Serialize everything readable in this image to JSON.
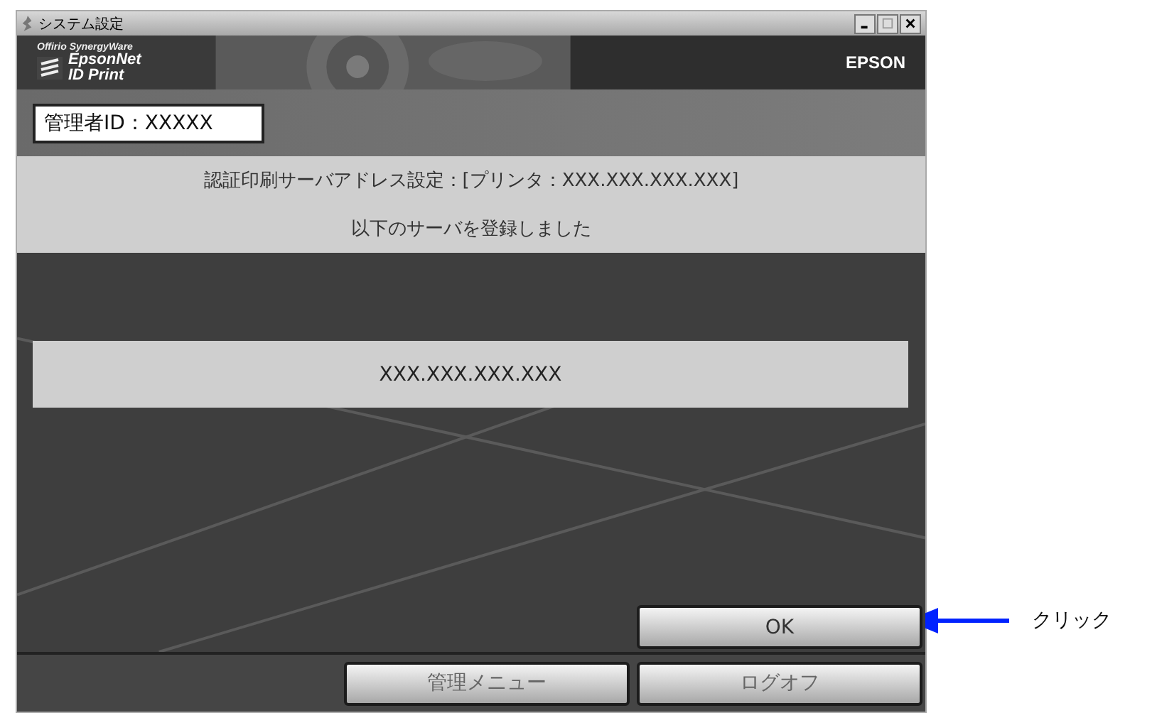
{
  "window": {
    "title": "システム設定"
  },
  "header": {
    "tagline": "Offirio SynergyWare",
    "product_line1": "EpsonNet",
    "product_line2": "ID Print",
    "brand": "EPSON"
  },
  "admin_id": {
    "value": "管理者ID：XXXXX"
  },
  "info": {
    "title": "認証印刷サーバアドレス設定：[プリンタ：XXX.XXX.XXX.XXX]",
    "message": "以下のサーバを登録しました"
  },
  "server": {
    "value": "XXX.XXX.XXX.XXX"
  },
  "ok_button": {
    "label": "OK"
  },
  "footer_buttons": [
    {
      "label": "管理メニュー"
    },
    {
      "label": "ログオフ"
    }
  ],
  "annotation": {
    "label": "クリック"
  }
}
